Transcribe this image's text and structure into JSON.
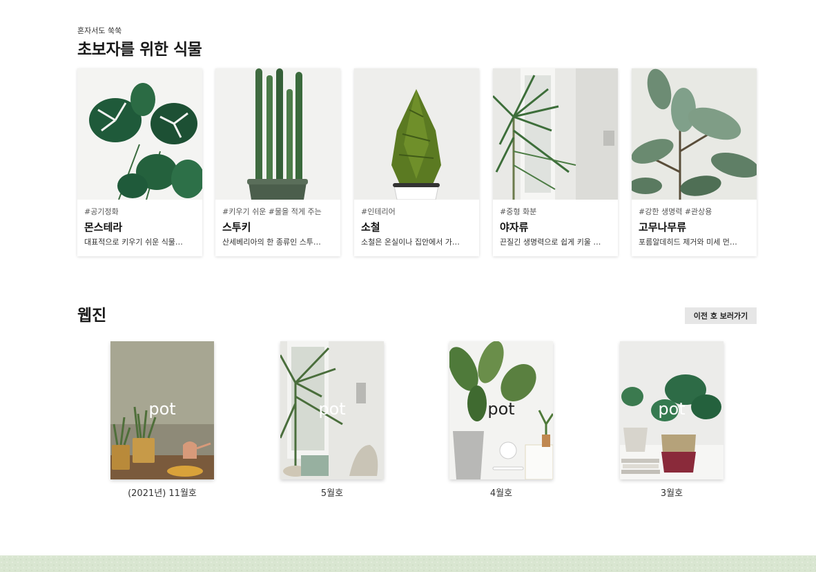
{
  "beginner": {
    "eyebrow": "혼자서도 쑥쑥",
    "title": "초보자를 위한 식물",
    "plants": [
      {
        "tags": "#공기정화",
        "name": "몬스테라",
        "desc": "대표적으로 키우기 쉬운 식물…",
        "image_icon": "monstera-plant-image"
      },
      {
        "tags": "#키우기 쉬운 #물을 적게 주는",
        "name": "스투키",
        "desc": "산세베리아의 한 종류인 스투…",
        "image_icon": "stuckyi-plant-image"
      },
      {
        "tags": "#인테리어",
        "name": "소철",
        "desc": "소철은 온실이나 집안에서 가…",
        "image_icon": "cycad-plant-image"
      },
      {
        "tags": "#중형 화분",
        "name": "야자류",
        "desc": "끈질긴 생명력으로 쉽게 키울 …",
        "image_icon": "palm-plant-image"
      },
      {
        "tags": "#강한 생명력 #관상용",
        "name": "고무나무류",
        "desc": "포름알데히드 제거와 미세 먼…",
        "image_icon": "rubber-tree-plant-image"
      }
    ]
  },
  "webzine": {
    "title": "웹진",
    "prev_button_label": "이전 호 보러가기",
    "issues": [
      {
        "cover_text": "pot",
        "label": "(2021년) 11월호"
      },
      {
        "cover_text": "pot",
        "label": "5월호"
      },
      {
        "cover_text": "pot",
        "label": "4월호"
      },
      {
        "cover_text": "pot",
        "label": "3월호"
      }
    ]
  },
  "colors": {
    "footer": "#d9e6d1",
    "button_bg": "#e6e6e6",
    "leaf_dark": "#1f5a3a",
    "leaf_mid": "#2e7a4b"
  }
}
